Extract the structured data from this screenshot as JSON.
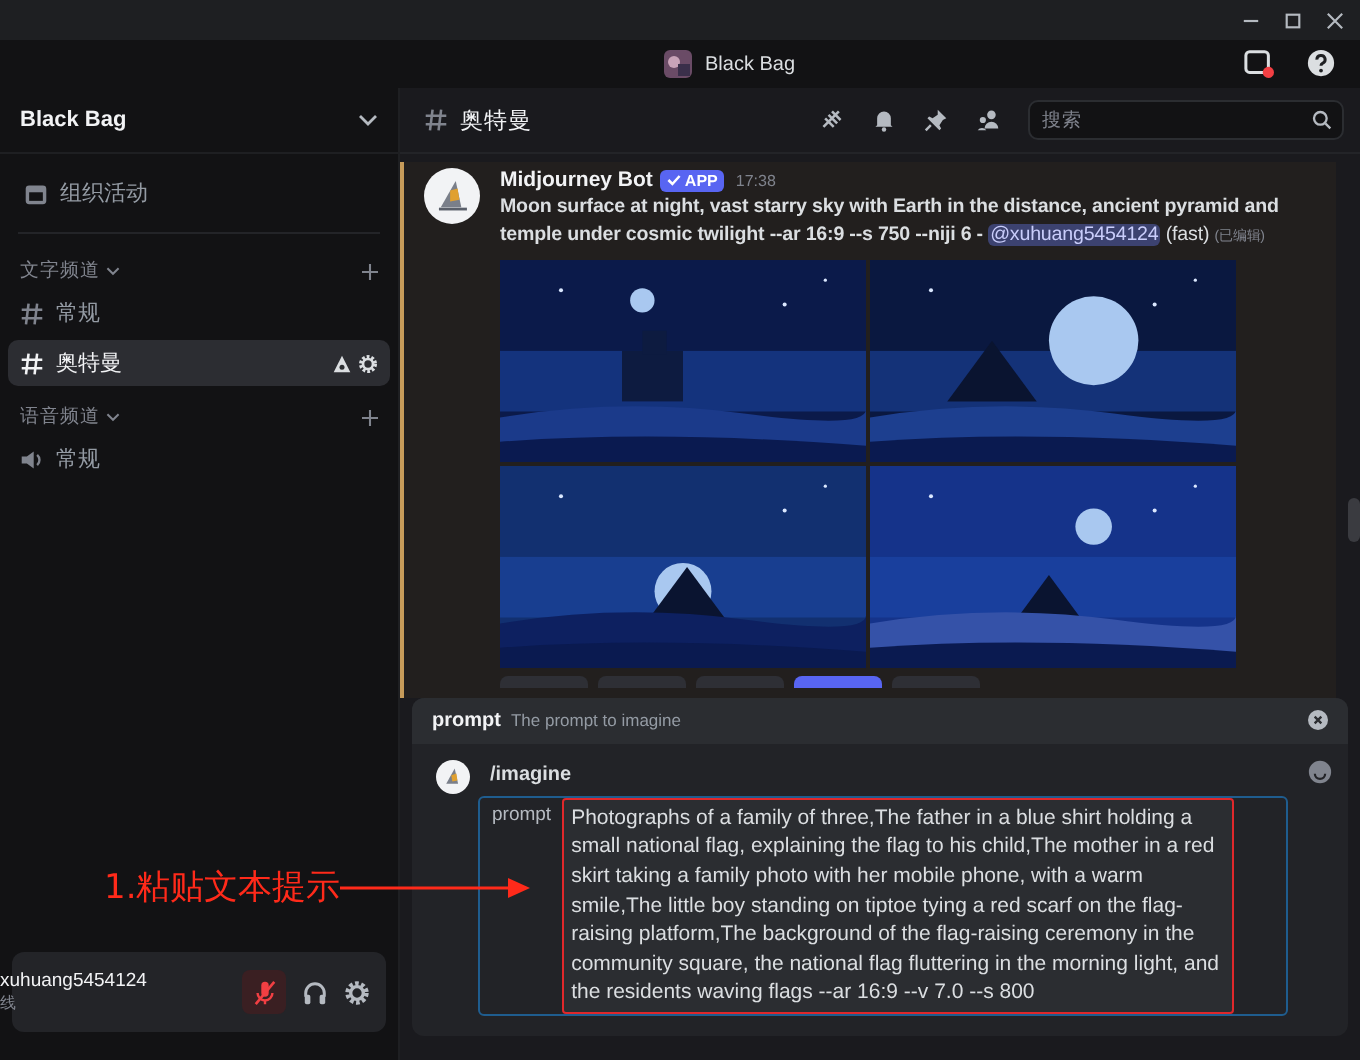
{
  "top_bar": {
    "server_name": "Black Bag"
  },
  "sidebar": {
    "server_name": "Black Bag",
    "events_label": "组织活动",
    "categories": [
      {
        "name": "文字频道",
        "kind": "text",
        "channels": [
          {
            "name": "常规",
            "selected": false
          },
          {
            "name": "奥特曼",
            "selected": true
          }
        ]
      },
      {
        "name": "语音频道",
        "kind": "voice",
        "channels": [
          {
            "name": "常规",
            "selected": false
          }
        ]
      }
    ]
  },
  "channel_header": {
    "name": "奥特曼",
    "search_placeholder": "搜索"
  },
  "message": {
    "author": "Midjourney Bot",
    "badge": "APP",
    "time": "17:38",
    "text": "Moon surface at night, vast starry sky with Earth in the distance, ancient pyramid and temple under cosmic twilight --ar 16:9 --s 750 --niji 6 -",
    "mention": "@xuhuang5454124",
    "speed": "(fast)",
    "edited": "(已编辑)"
  },
  "command": {
    "option_name": "prompt",
    "option_description": "The prompt to imagine",
    "command": "/imagine",
    "field_label": "prompt",
    "value": "Photographs of a family of three,The father in a blue shirt holding a small national flag, explaining the flag to his child,The mother in a red skirt taking a family photo with her mobile phone, with a warm smile,The little boy standing on tiptoe tying a red scarf on the flag-raising platform,The background of the flag-raising ceremony in the community square, the national flag fluttering in the morning light, and the residents waving flags --ar 16:9 --v 7.0 --s 800"
  },
  "user_panel": {
    "username": "xuhuang5454124",
    "status": "线",
    "muted": true
  },
  "annotation": {
    "label": "1.粘贴文本提示"
  }
}
